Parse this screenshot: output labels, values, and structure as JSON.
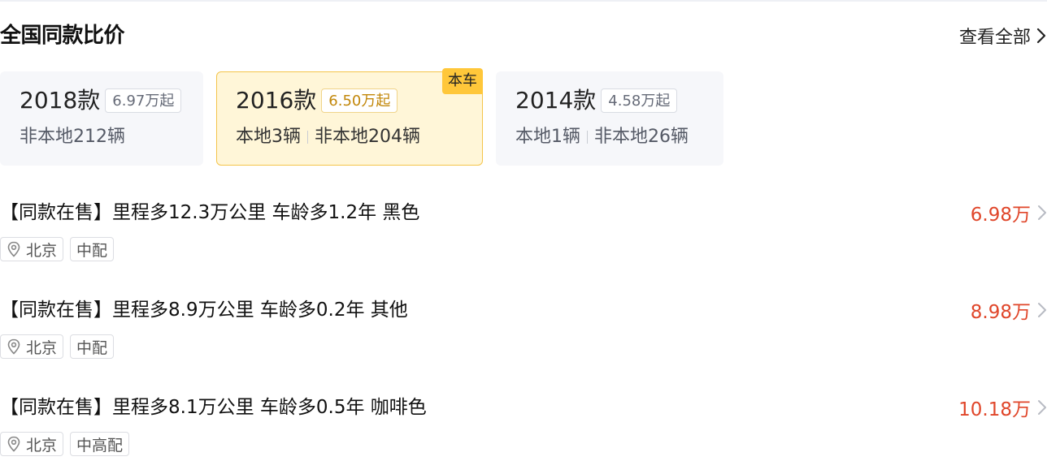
{
  "header": {
    "title": "全国同款比价",
    "view_all": "查看全部"
  },
  "cards": [
    {
      "year": "2018款",
      "price": "6.97万起",
      "counts": [
        "非本地212辆"
      ],
      "badge": ""
    },
    {
      "year": "2016款",
      "price": "6.50万起",
      "counts": [
        "本地3辆",
        "非本地204辆"
      ],
      "badge": "本车"
    },
    {
      "year": "2014款",
      "price": "4.58万起",
      "counts": [
        "本地1辆",
        "非本地26辆"
      ],
      "badge": ""
    }
  ],
  "listings": [
    {
      "title": "【同款在售】里程多12.3万公里 车龄多1.2年 黑色",
      "price": "6.98万",
      "city": "北京",
      "trim": "中配"
    },
    {
      "title": "【同款在售】里程多8.9万公里 车龄多0.2年 其他",
      "price": "8.98万",
      "city": "北京",
      "trim": "中配"
    },
    {
      "title": "【同款在售】里程多8.1万公里 车龄多0.5年 咖啡色",
      "price": "10.18万",
      "city": "北京",
      "trim": "中高配"
    }
  ],
  "colors": {
    "price_red": "#e0462a",
    "highlight_bg": "#fff6d8",
    "highlight_border": "#f4c44a",
    "badge_bg": "#ffc73a",
    "card_bg": "#f6f7fa"
  },
  "icons": {
    "view_all": "chevron-right-icon",
    "location": "location-pin-icon",
    "listing_arrow": "chevron-right-icon"
  }
}
